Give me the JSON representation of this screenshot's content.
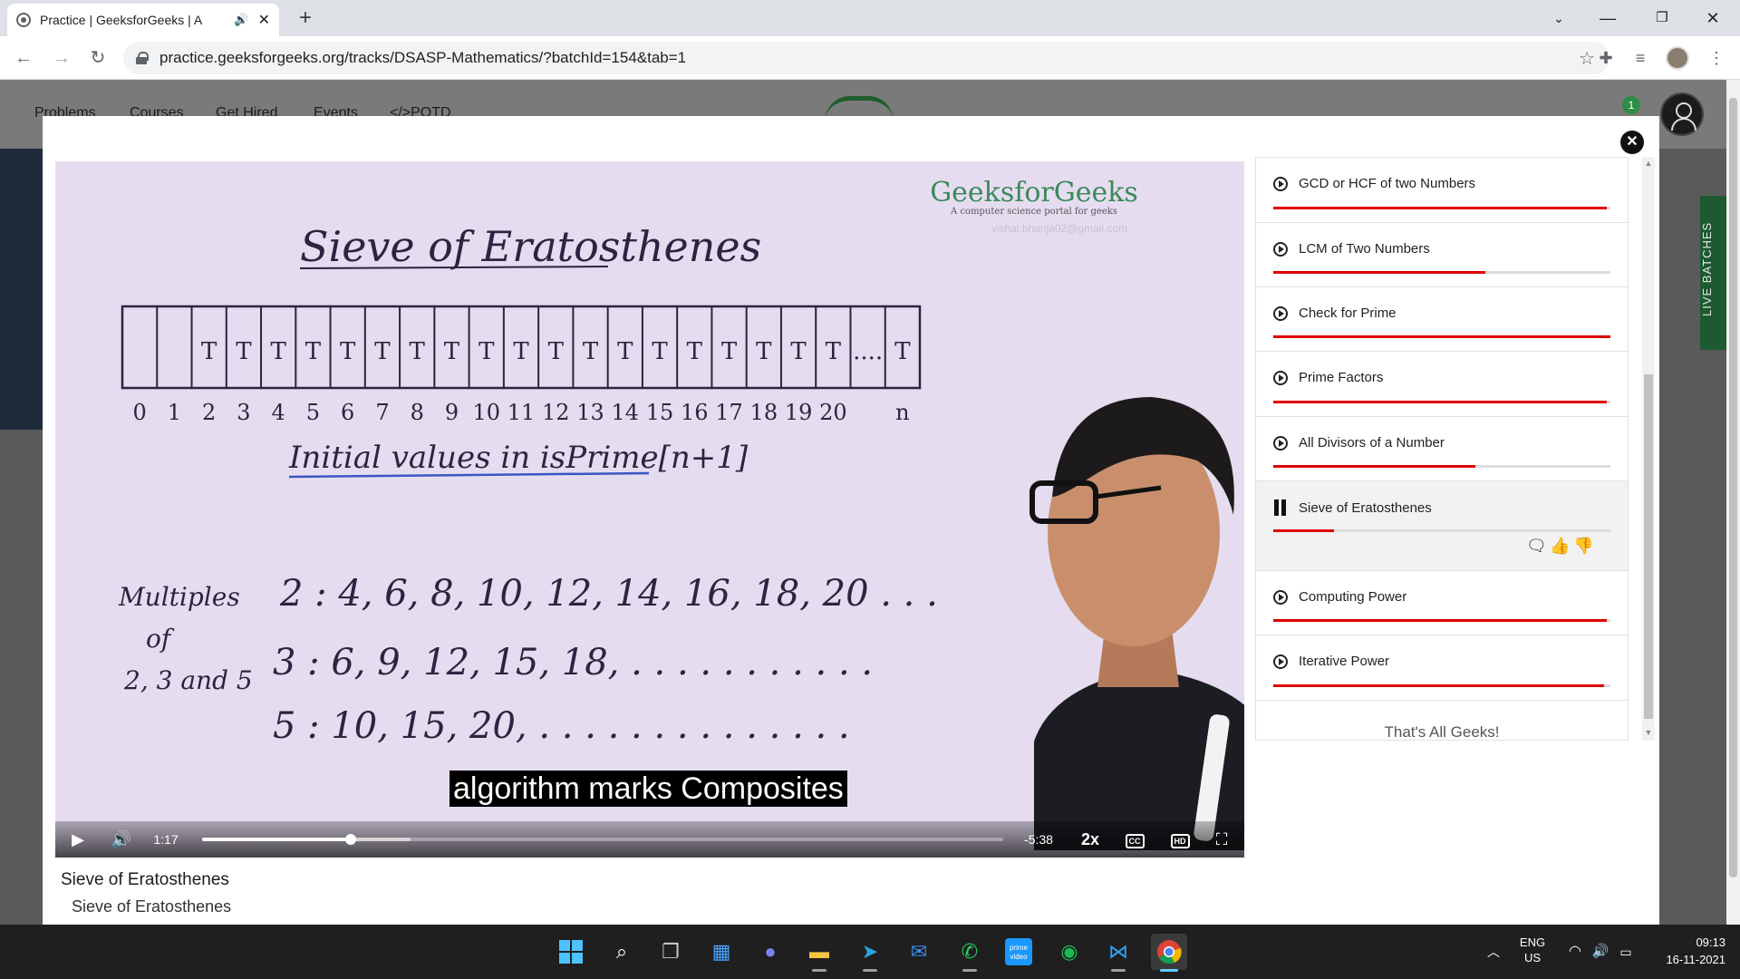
{
  "browser": {
    "tab_title": "Practice | GeeksforGeeks | A",
    "url": "practice.geeksforgeeks.org/tracks/DSASP-Mathematics/?batchId=154&tab=1"
  },
  "site_nav": {
    "links": [
      "Problems",
      "Courses",
      "Get Hired",
      "Events",
      "</>POTD"
    ],
    "notification_count": "1",
    "side_tab": "LIVE BATCHES"
  },
  "video": {
    "watermark_brand": "GeeksforGeeks",
    "watermark_tagline": "A computer science portal for geeks",
    "watermark_email": "vishal.bhanja02@gmail.com",
    "board_title": "Sieve of Eratosthenes",
    "array_cells": [
      "",
      "",
      "T",
      "T",
      "T",
      "T",
      "T",
      "T",
      "T",
      "T",
      "T",
      "T",
      "T",
      "T",
      "T",
      "T",
      "T",
      "T",
      "T",
      "T",
      "T",
      "....",
      "T"
    ],
    "array_indices": [
      "0",
      "1",
      "2",
      "3",
      "4",
      "5",
      "6",
      "7",
      "8",
      "9",
      "10",
      "11",
      "12",
      "13",
      "14",
      "15",
      "16",
      "17",
      "18",
      "19",
      "20",
      "",
      "n"
    ],
    "board_subtitle": "Initial values in isPrime[n+1]",
    "multiples_label": [
      "Multiples",
      "of",
      "2, 3 and 5"
    ],
    "multiples_rows": [
      "2 : 4, 6, 8, 10, 12, 14, 16, 18, 20 . . .",
      "3 : 6, 9, 12, 15, 18, . . . . . . . . . . .",
      "5 : 10, 15, 20, . . . . . . . . . . . . . ."
    ],
    "caption": "algorithm marks Composites",
    "current_time": "1:17",
    "remaining_time": "-5:38",
    "speed": "2x",
    "progress": 0.185,
    "buffered": 0.26,
    "title": "Sieve of Eratosthenes",
    "subtitle": "Sieve of Eratosthenes"
  },
  "playlist": {
    "items": [
      {
        "label": "GCD or HCF of two Numbers",
        "progress": 0.99,
        "state": "completed"
      },
      {
        "label": "LCM of Two Numbers",
        "progress": 0.63,
        "state": "partial"
      },
      {
        "label": "Check for Prime",
        "progress": 1.0,
        "state": "completed"
      },
      {
        "label": "Prime Factors",
        "progress": 0.99,
        "state": "completed"
      },
      {
        "label": "All Divisors of a Number",
        "progress": 0.6,
        "state": "partial"
      },
      {
        "label": "Sieve of Eratosthenes",
        "progress": 0.18,
        "state": "playing"
      },
      {
        "label": "Computing Power",
        "progress": 0.99,
        "state": "completed"
      },
      {
        "label": "Iterative Power",
        "progress": 0.98,
        "state": "completed"
      }
    ],
    "footer": "That's All Geeks!"
  },
  "taskbar": {
    "lang": "ENG",
    "region": "US",
    "time": "09:13",
    "date": "16-11-2021",
    "prime_label": "prime video"
  },
  "colors": {
    "progress_red": "#e00000",
    "gfg_green": "#2f8d46",
    "board_bg": "#e6dcf0",
    "ink": "#2a2540"
  }
}
